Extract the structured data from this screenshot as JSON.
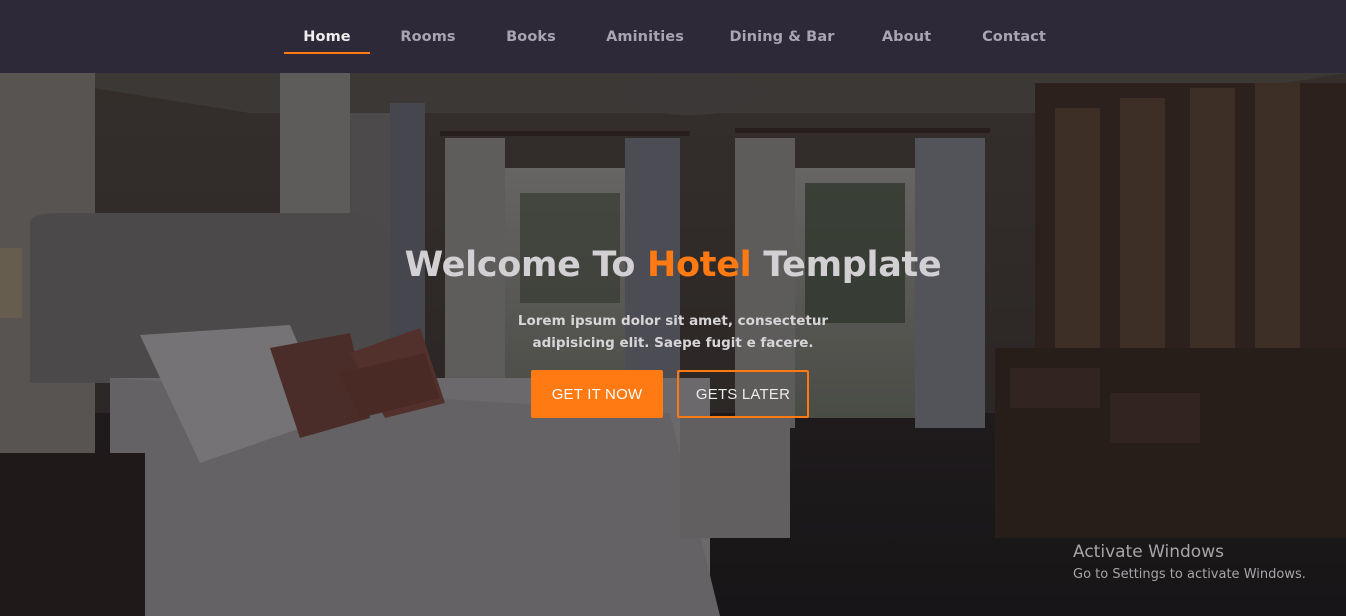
{
  "nav": {
    "items": [
      {
        "label": "Home",
        "active": true
      },
      {
        "label": "Rooms",
        "active": false
      },
      {
        "label": "Books",
        "active": false
      },
      {
        "label": "Aminities",
        "active": false
      },
      {
        "label": "Dining & Bar",
        "active": false
      },
      {
        "label": "About",
        "active": false
      },
      {
        "label": "Contact",
        "active": false
      }
    ]
  },
  "hero": {
    "title_part1": "Welcome To ",
    "title_accent": "Hotel",
    "title_part2": " Template",
    "subtitle_line1": "Lorem ipsum dolor sit amet, consectetur",
    "subtitle_line2": "adipisicing elit. Saepe fugit e facere.",
    "primary_button": "GET IT NOW",
    "secondary_button": "GETS LATER",
    "background_icon": "hotel-bedroom-photo"
  },
  "watermark": {
    "title": "Activate Windows",
    "subtitle": "Go to Settings to activate Windows."
  },
  "colors": {
    "accent": "#ff7a12",
    "nav_bg": "#2e2939",
    "nav_text": "#a9a4b1",
    "nav_active_text": "#eeeeee"
  }
}
